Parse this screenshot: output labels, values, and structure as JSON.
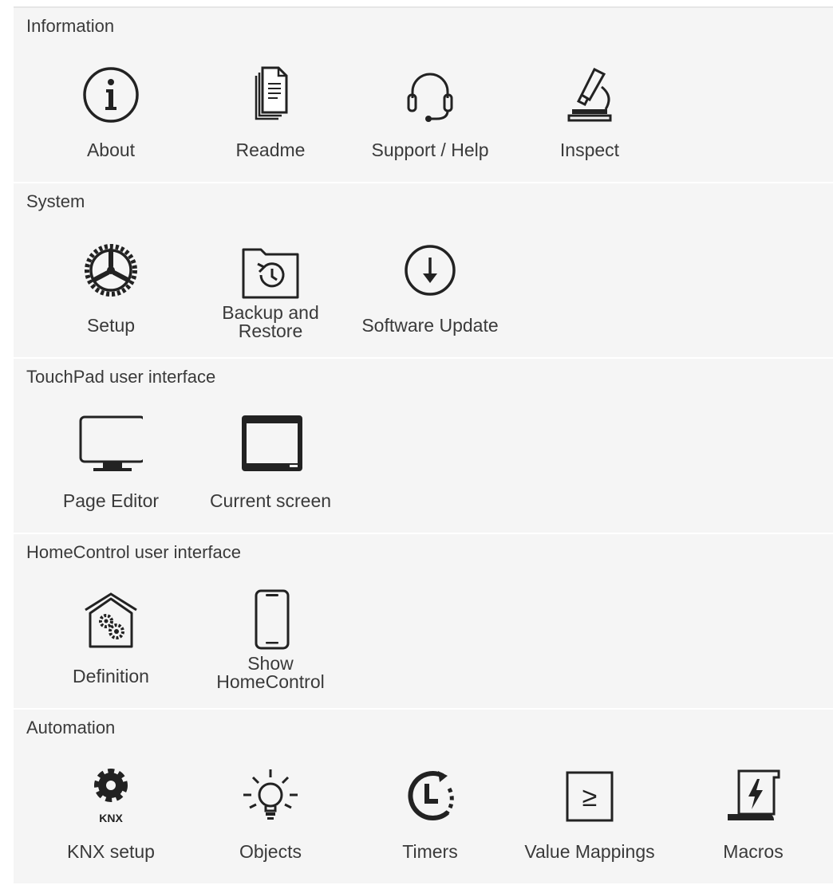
{
  "sections": [
    {
      "title": "Information",
      "items": [
        {
          "label": "About",
          "icon": "info-icon"
        },
        {
          "label": "Readme",
          "icon": "document-icon"
        },
        {
          "label": "Support / Help",
          "icon": "headset-icon"
        },
        {
          "label": "Inspect",
          "icon": "microscope-icon"
        }
      ]
    },
    {
      "title": "System",
      "items": [
        {
          "label": "Setup",
          "icon": "gear-wheel-icon"
        },
        {
          "label": "Backup and Restore",
          "line1": "Backup and",
          "line2": "Restore",
          "icon": "folder-restore-icon"
        },
        {
          "label": "Software Update",
          "icon": "download-circle-icon"
        }
      ]
    },
    {
      "title": "TouchPad user interface",
      "items": [
        {
          "label": "Page Editor",
          "icon": "monitor-icon"
        },
        {
          "label": "Current screen",
          "icon": "screen-window-icon"
        }
      ]
    },
    {
      "title": "HomeControl user interface",
      "items": [
        {
          "label": "Definition",
          "icon": "house-gears-icon"
        },
        {
          "label": "Show HomeControl",
          "line1": "Show",
          "line2": "HomeControl",
          "icon": "smartphone-icon"
        }
      ]
    },
    {
      "title": "Automation",
      "items": [
        {
          "label": "KNX setup",
          "icon": "knx-gear-icon",
          "icon_text": "KNX"
        },
        {
          "label": "Objects",
          "icon": "lightbulb-icon"
        },
        {
          "label": "Timers",
          "icon": "timer-icon"
        },
        {
          "label": "Value Mappings",
          "icon": "value-mapping-icon",
          "icon_text": "≥"
        },
        {
          "label": "Macros",
          "icon": "macro-scroll-icon"
        }
      ]
    }
  ],
  "colors": {
    "section_background": "#f5f5f5",
    "text": "#3a3a3a",
    "icon_stroke": "#222222"
  }
}
